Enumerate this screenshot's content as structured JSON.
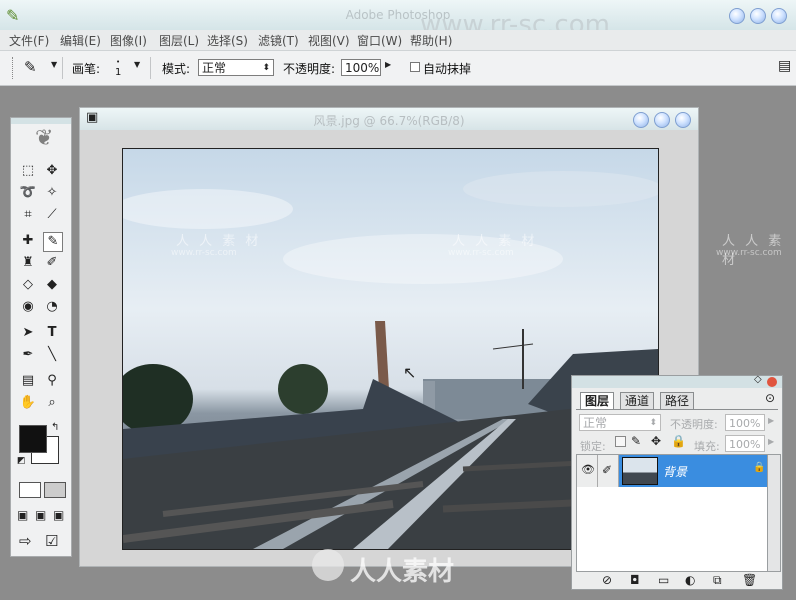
{
  "app": {
    "title": "Adobe Photoshop",
    "watermark_url": "www.rr-sc.com"
  },
  "menu": [
    "文件(F)",
    "编辑(E)",
    "图像(I)",
    "图层(L)",
    "选择(S)",
    "滤镜(T)",
    "视图(V)",
    "窗口(W)",
    "帮助(H)"
  ],
  "options": {
    "brush_label": "画笔:",
    "brush_size": "1",
    "mode_label": "模式:",
    "mode_value": "正常",
    "opacity_label": "不透明度:",
    "opacity_value": "100%",
    "auto_erase_label": "自动抹掉"
  },
  "document": {
    "title": "风景.jpg @ 66.7%(RGB/8)"
  },
  "layers_panel": {
    "tabs": [
      "图层",
      "通道",
      "路径"
    ],
    "blend_mode": "正常",
    "opacity_label": "不透明度:",
    "opacity_value": "100%",
    "lock_label": "锁定:",
    "fill_label": "填充:",
    "fill_value": "100%",
    "layer_name": "背景"
  },
  "watermark": {
    "text": "人 人 素 材",
    "url": "www.rr-sc.com",
    "logo_text": "人人素材"
  },
  "colors": {
    "selection": "#3a8de0",
    "foreground": "#111111",
    "background": "#ffffff"
  }
}
